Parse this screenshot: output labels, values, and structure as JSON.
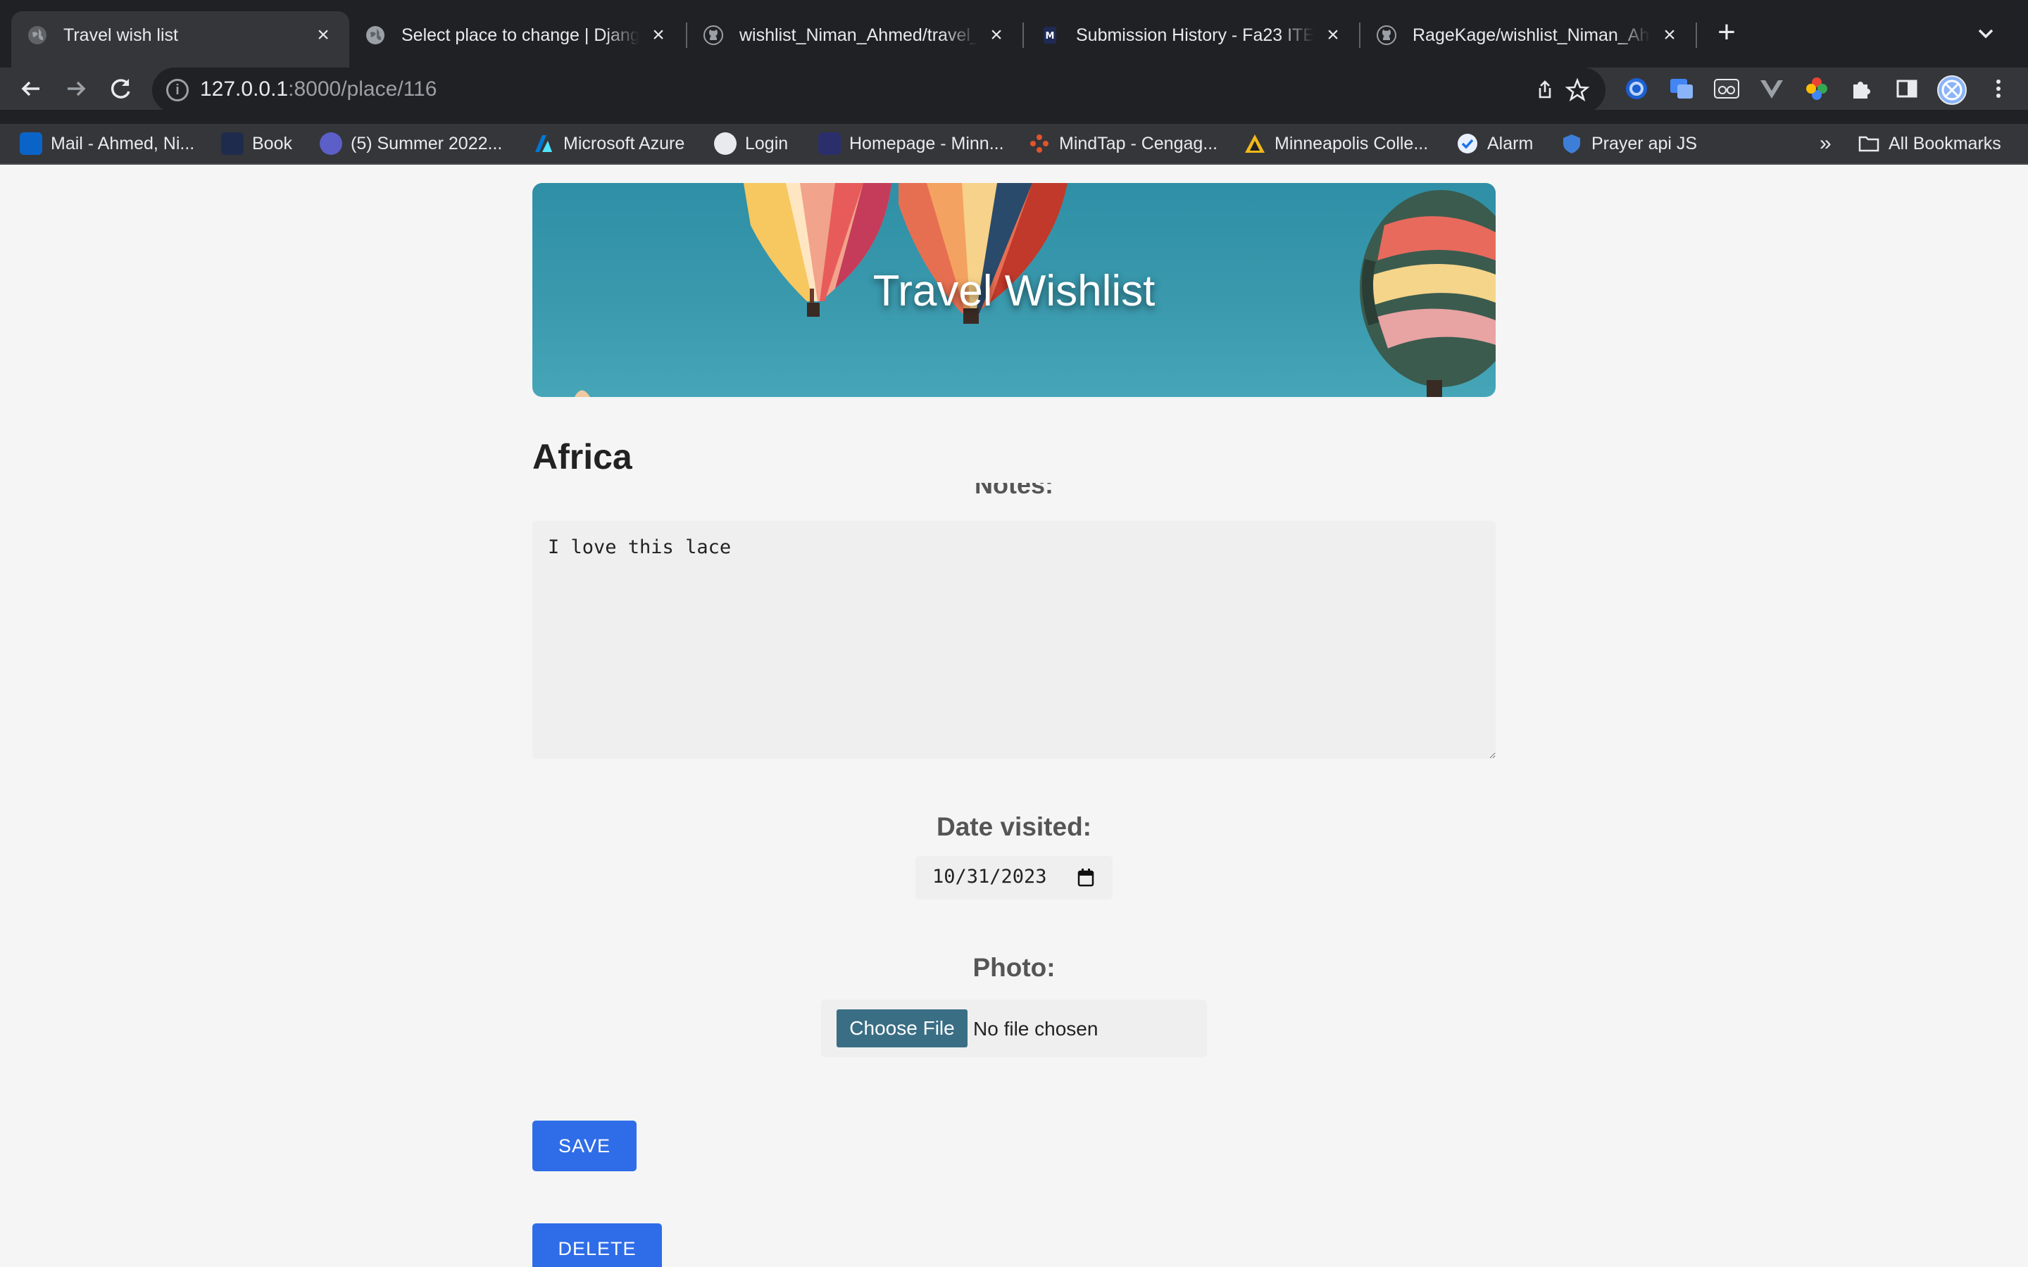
{
  "browser": {
    "tabs": [
      {
        "title": "Travel wish list",
        "active": true,
        "icon": "globe-icon"
      },
      {
        "title": "Select place to change | Djang",
        "active": false,
        "icon": "globe-icon"
      },
      {
        "title": "wishlist_Niman_Ahmed/travel_",
        "active": false,
        "icon": "github-icon"
      },
      {
        "title": "Submission History - Fa23 ITE",
        "active": false,
        "icon": "school-icon"
      },
      {
        "title": "RageKage/wishlist_Niman_Ahm",
        "active": false,
        "icon": "github-icon"
      }
    ],
    "url_host": "127.0.0.1",
    "url_rest": ":8000/place/116",
    "bookmarks": [
      {
        "label": "Mail - Ahmed, Ni...",
        "color": "#0a64c8"
      },
      {
        "label": "Book",
        "color": "#1f2b4d"
      },
      {
        "label": "(5) Summer 2022...",
        "color": "#5b5fc7"
      },
      {
        "label": "Microsoft Azure",
        "color": "#0078d4"
      },
      {
        "label": "Login",
        "color": "#e8eaed"
      },
      {
        "label": "Homepage - Minn...",
        "color": "#2a2f6b"
      },
      {
        "label": "MindTap - Cengag...",
        "color": "#e2542a"
      },
      {
        "label": "Minneapolis Colle...",
        "color": "#f1b81a"
      },
      {
        "label": "Alarm",
        "color": "#e8f0fe"
      },
      {
        "label": "Prayer api JS",
        "color": "#3d7fd8"
      }
    ],
    "overflow": "»",
    "all_bookmarks": "All Bookmarks"
  },
  "page": {
    "banner_title": "Travel Wishlist",
    "place_name": "Africa",
    "notes_label": "Notes:",
    "notes_value": "I love this lace",
    "date_label": "Date visited:",
    "date_value": "10/31/2023",
    "photo_label": "Photo:",
    "choose_file": "Choose File",
    "no_file": "No file chosen",
    "save": "SAVE",
    "delete": "DELETE"
  },
  "colors": {
    "accent_button": "#2f6de8",
    "banner_sky": "#3a99ad",
    "file_button": "#3a6e84"
  }
}
